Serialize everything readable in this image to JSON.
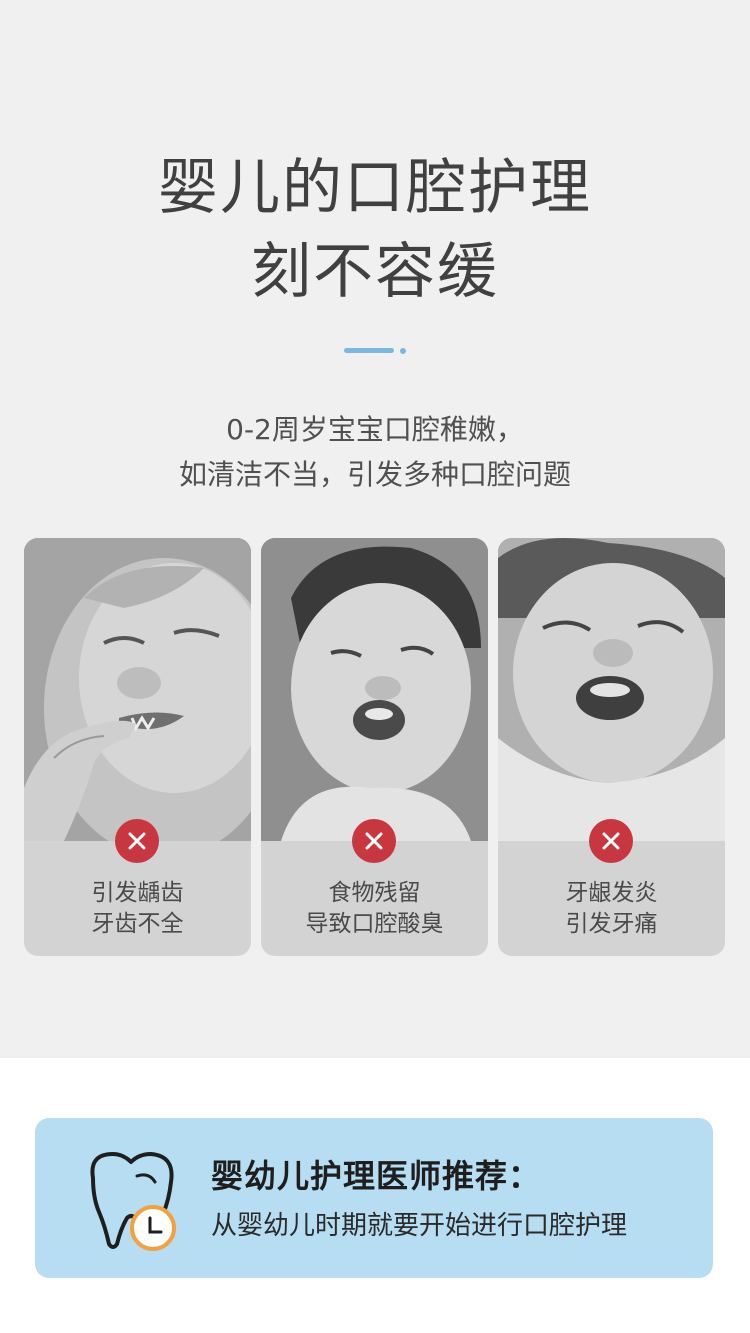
{
  "heading": {
    "line1": "婴儿的口腔护理",
    "line2": "刻不容缓"
  },
  "intro": {
    "line1": "0-2周岁宝宝口腔稚嫩，",
    "line2": "如清洁不当，引发多种口腔问题"
  },
  "problems": [
    {
      "line1": "引发龋齿",
      "line2": "牙齿不全",
      "icon": "baby-finger-in-mouth-photo"
    },
    {
      "line1": "食物残留",
      "line2": "导致口腔酸臭",
      "icon": "baby-crying-photo"
    },
    {
      "line1": "牙龈发炎",
      "line2": "引发牙痛",
      "icon": "baby-screaming-photo"
    }
  ],
  "recommendation": {
    "title": "婴幼儿护理医师推荐：",
    "text": "从婴幼儿时期就要开始进行口腔护理",
    "icon": "tooth-clock-icon"
  },
  "colors": {
    "accent": "#7ab8e0",
    "badge": "#c8373f",
    "rec_bg": "#b6ddf2",
    "clock": "#f2a13b"
  }
}
